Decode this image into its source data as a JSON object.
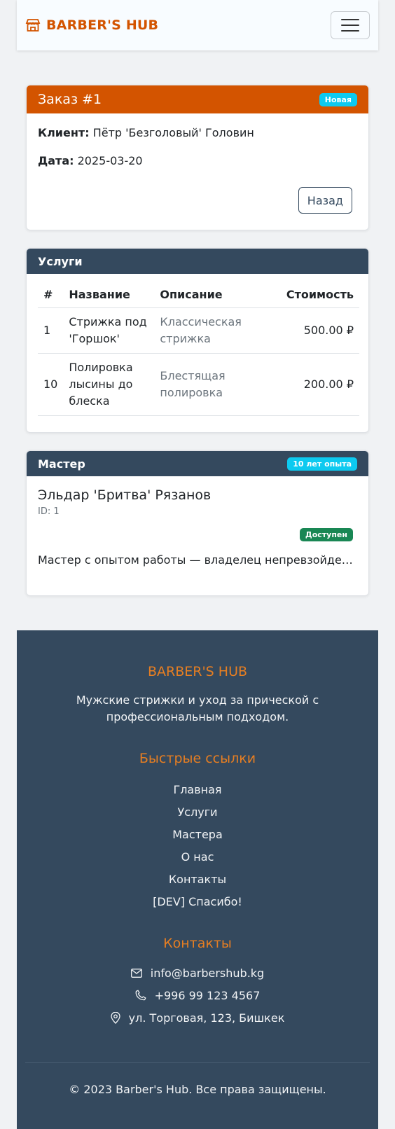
{
  "navbar": {
    "brand": "BARBER'S HUB",
    "brand_icon": "shop-icon",
    "toggler_icon": "hamburger-icon"
  },
  "order": {
    "title": "Заказ #1",
    "status_badge": "Новая",
    "client_label": "Клиент:",
    "client_value": "Пётр 'Безголовый' Головин",
    "date_label": "Дата:",
    "date_value": "2025-03-20",
    "back_button": "Назад"
  },
  "services": {
    "header": "Услуги",
    "columns": [
      "#",
      "Название",
      "Описание",
      "Стоимость"
    ],
    "rows": [
      {
        "num": "1",
        "name": "Стрижка под 'Горшок'",
        "description": "Классическая стрижка",
        "price": "500.00 ₽"
      },
      {
        "num": "10",
        "name": "Полировка лысины до блеска",
        "description": "Блестящая полировка",
        "price": "200.00 ₽"
      }
    ]
  },
  "master": {
    "header": "Мастер",
    "experience_badge": "10 лет опыта",
    "name": "Эльдар 'Бритва' Рязанов",
    "id_text": "ID: 1",
    "availability": "Доступен",
    "description": "Мастер с опытом работы — владелец непревзойденной ..."
  },
  "footer": {
    "brand": "BARBER'S HUB",
    "tagline": "Мужские стрижки и уход за прической с профессиональным подходом.",
    "links_heading": "Быстрые ссылки",
    "links": [
      "Главная",
      "Услуги",
      "Мастера",
      "О нас",
      "Контакты",
      "[DEV] Спасибо!"
    ],
    "contacts_heading": "Контакты",
    "email": "info@barbershub.kg",
    "phone": "+996 99 123 4567",
    "address": "ул. Торговая, 123, Бишкек",
    "copyright": "© 2023 Barber's Hub. Все права защищены."
  },
  "colors": {
    "brand": "#d35400",
    "accent": "#e67e22",
    "dark": "#34495e",
    "badge_info": "#0dcaf0",
    "badge_success": "#198754"
  }
}
